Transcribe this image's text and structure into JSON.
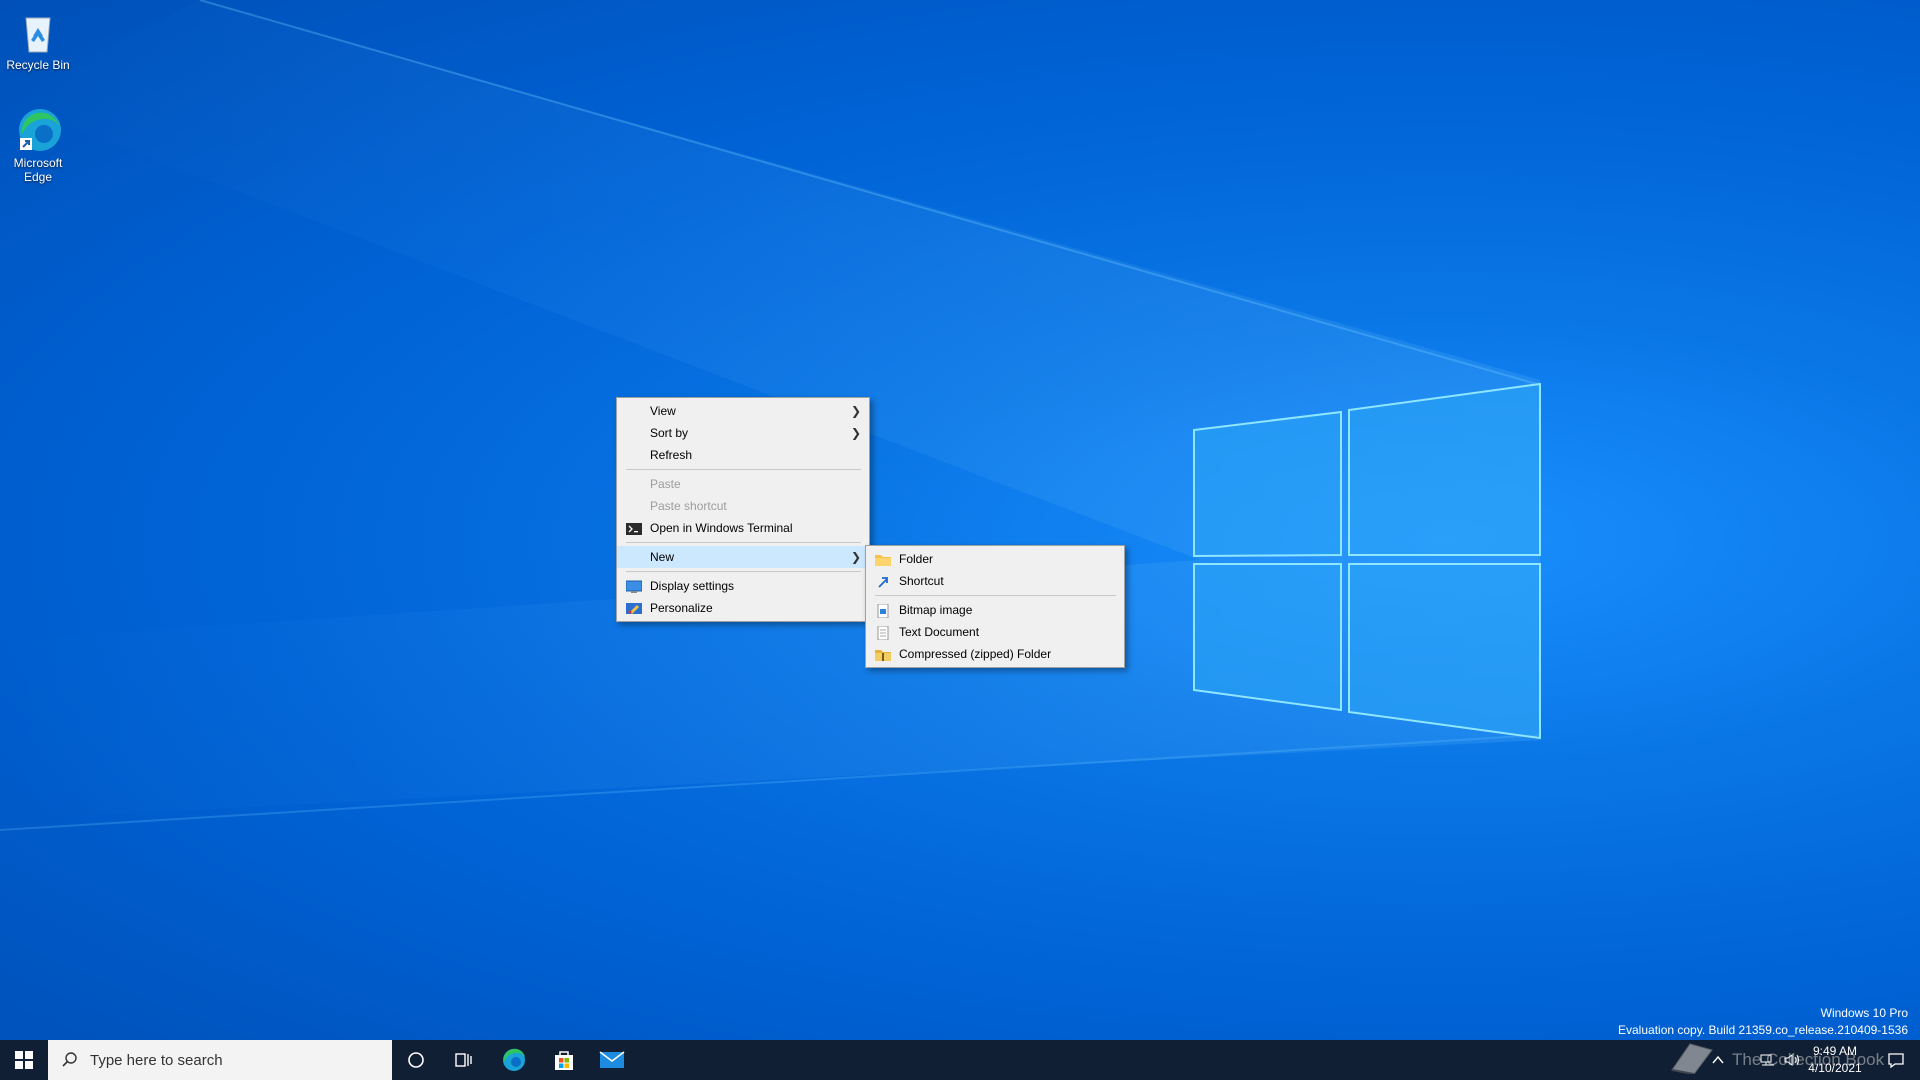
{
  "desktop": {
    "icons": [
      {
        "label": "Recycle Bin"
      },
      {
        "label": "Microsoft Edge"
      }
    ]
  },
  "context_menu": {
    "items": [
      {
        "label": "View",
        "has_submenu": true
      },
      {
        "label": "Sort by",
        "has_submenu": true
      },
      {
        "label": "Refresh"
      },
      {
        "label": "Paste",
        "disabled": true
      },
      {
        "label": "Paste shortcut",
        "disabled": true
      },
      {
        "label": "Open in Windows Terminal",
        "icon": "terminal-icon"
      },
      {
        "label": "New",
        "has_submenu": true,
        "highlighted": true
      },
      {
        "label": "Display settings",
        "icon": "display-icon"
      },
      {
        "label": "Personalize",
        "icon": "personalize-icon"
      }
    ]
  },
  "new_submenu": {
    "items": [
      {
        "label": "Folder",
        "icon": "folder-icon"
      },
      {
        "label": "Shortcut",
        "icon": "shortcut-icon"
      },
      {
        "label": "Bitmap image",
        "icon": "bitmap-icon"
      },
      {
        "label": "Text Document",
        "icon": "text-document-icon"
      },
      {
        "label": "Compressed (zipped) Folder",
        "icon": "zip-folder-icon"
      }
    ]
  },
  "watermark": {
    "edition": "Windows 10 Pro",
    "build": "Evaluation copy. Build 21359.co_release.210409-1536"
  },
  "taskbar": {
    "search_placeholder": "Type here to search",
    "clock_time": "9:49 AM",
    "clock_date": "4/10/2021",
    "overlay_text": "The Collection Book"
  },
  "colors": {
    "desktop_blue": "#0a76e6",
    "menu_bg": "#f0f0f0",
    "menu_highlight": "#cce8ff",
    "taskbar_bg": "#101f33"
  }
}
